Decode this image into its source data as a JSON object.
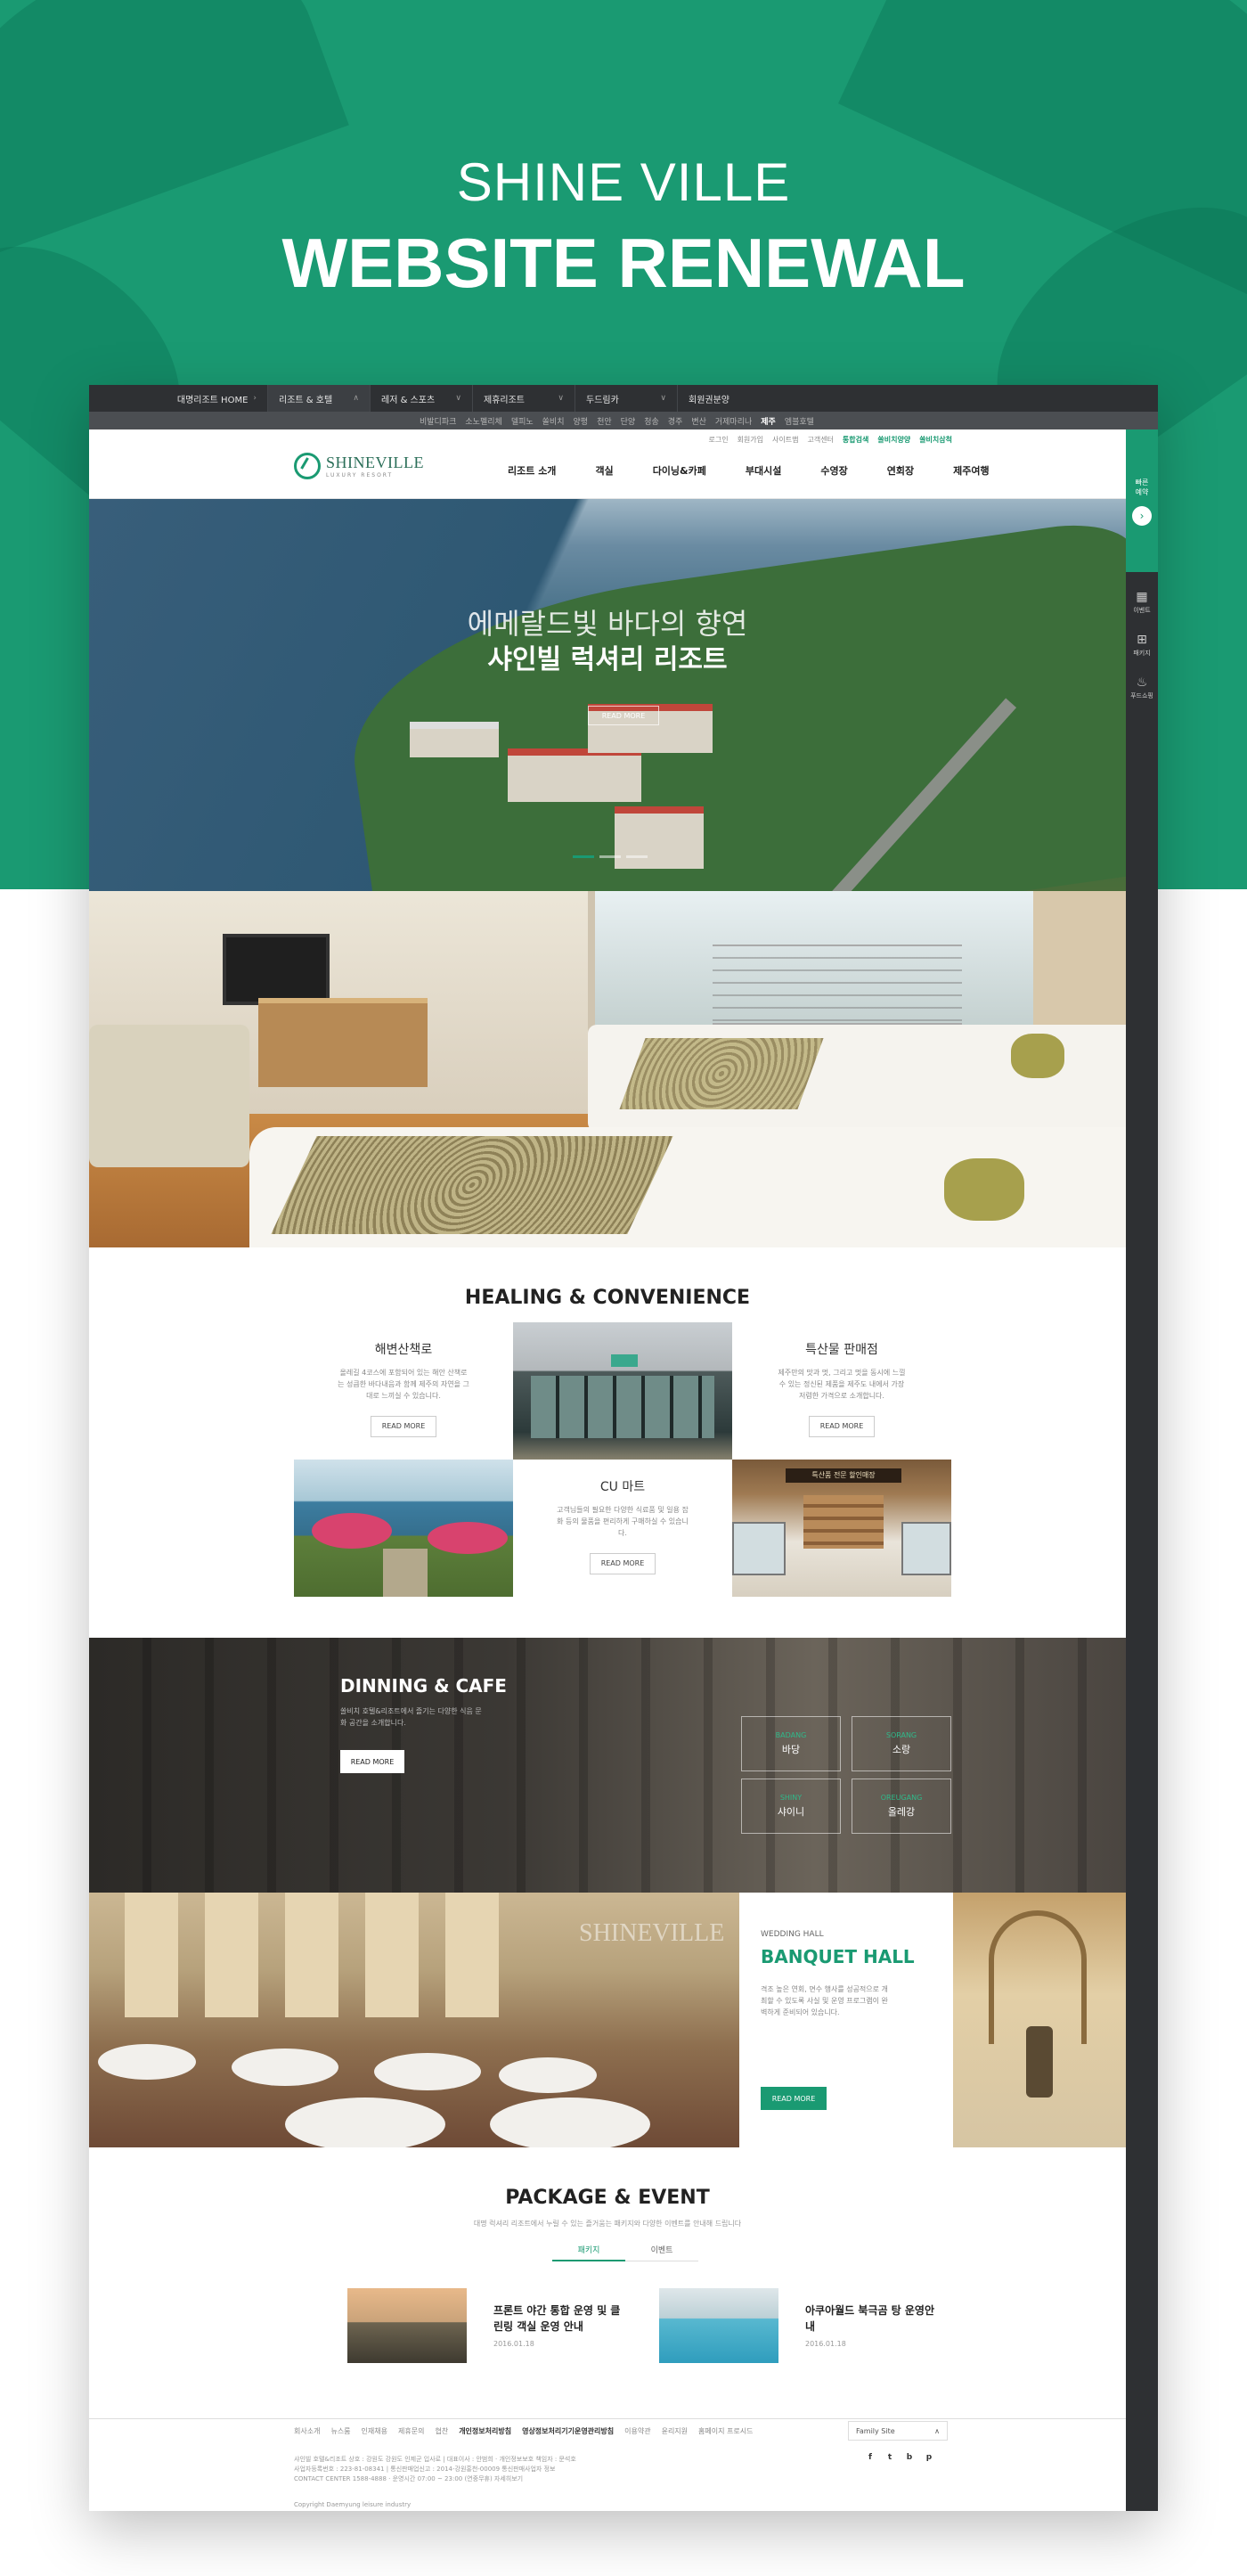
{
  "hero": {
    "line1": "SHINE VILLE",
    "line2": "WEBSITE RENEWAL",
    "bg_color": "#1a9a72"
  },
  "topbar": {
    "home_label": "대명리조트 HOME",
    "menus": [
      {
        "label": "리조트 & 호텔",
        "active": true
      },
      {
        "label": "레저 & 스포츠",
        "active": false
      },
      {
        "label": "제휴리조트",
        "active": false
      },
      {
        "label": "두드림카",
        "active": false
      },
      {
        "label": "회원권분양",
        "active": false
      }
    ]
  },
  "subbar": {
    "items": [
      "비발디파크",
      "소노펠리체",
      "델피노",
      "쏠비치",
      "양평",
      "천안",
      "단양",
      "청송",
      "경주",
      "변산",
      "거제마리나",
      "제주",
      "엠블호텔"
    ],
    "current": "제주"
  },
  "header": {
    "logo_name": "SHINEVILLE",
    "logo_sub": "LUXURY RESORT",
    "util_links": [
      "로그인",
      "회원가입",
      "사이트맵",
      "고객센터"
    ],
    "util_green": [
      "통합검색",
      "쏠비치양양",
      "쏠비치삼척"
    ],
    "gnb": [
      "리조트 소개",
      "객실",
      "다이닝&카페",
      "부대시설",
      "수영장",
      "연회장",
      "제주여행"
    ]
  },
  "quick": {
    "top_label": "빠른 예약",
    "items": [
      {
        "label": "이벤트",
        "icon": "calendar-icon"
      },
      {
        "label": "패키지",
        "icon": "gift-icon"
      },
      {
        "label": "푸드쇼핑",
        "icon": "food-icon"
      }
    ]
  },
  "slide": {
    "caption1": "에메랄드빛 바다의 향연",
    "caption2": "샤인빌 럭셔리 리조트",
    "button": "READ MORE"
  },
  "healing": {
    "title": "HEALING & CONVENIENCE",
    "items": [
      {
        "title": "해변산책로",
        "desc": "올레길 4코스에 포함되어 있는 해안 산책로는 성큼한 바다내음과 함께 제주의 자연을 그대로 느끼실 수 있습니다.",
        "button": "READ MORE"
      },
      {
        "title": "특산물 판매점",
        "desc": "제주만의 맛과 멋, 그리고 멋을 동시에 느낄 수 있는 정신된 제품을 제주도 내에서 가장 저렴한 가격으로 소개합니다.",
        "button": "READ MORE"
      },
      {
        "title": "CU 마트",
        "desc": "고객님들의 필요한 다양한 식료품 및 일용 잡화 등의 물품을 편리하게 구매하실 수 있습니다.",
        "button": "READ MORE"
      }
    ],
    "store_sign": "특산품 전문 할인매장"
  },
  "dining": {
    "title": "DINNING & CAFE",
    "desc": "쏠비치 호텔&리조트에서 즐기는 다양한 식음 문화 공간을 소개합니다.",
    "button": "READ MORE",
    "venues": [
      {
        "en": "BADANG",
        "ko": "바당"
      },
      {
        "en": "SORANG",
        "ko": "소랑"
      },
      {
        "en": "SHINY",
        "ko": "샤이니"
      },
      {
        "en": "OREUGANG",
        "ko": "올레강"
      }
    ]
  },
  "banquet": {
    "kicker": "WEDDING HALL",
    "title": "BANQUET HALL",
    "desc": "격조 높은 연회, 면수 행사를 성공적으로 개최할 수 있도록 사실 및 운영 프로그램이 완벽하게 준비되어 있습니다.",
    "button": "READ MORE",
    "watermark": "SHINEVILLE"
  },
  "package": {
    "title": "PACKAGE & EVENT",
    "desc": "대명 럭셔리 리조트에서 누릴 수 있는 즐거움는 패키지와 다양한 이벤트를 안내해 드립니다",
    "tabs": [
      {
        "label": "패키지",
        "active": true
      },
      {
        "label": "이벤트",
        "active": false
      }
    ],
    "items": [
      {
        "title": "프론트 야간 통합 운영 및 클린링 객실 운영 안내",
        "date": "2016.01.18"
      },
      {
        "title": "아쿠아월드 북극곰 탕 운영안내",
        "date": "2016.01.18"
      }
    ]
  },
  "footer": {
    "links": [
      {
        "label": "회사소개",
        "bold": false
      },
      {
        "label": "뉴스룸",
        "bold": false
      },
      {
        "label": "인재채용",
        "bold": false
      },
      {
        "label": "제휴문의",
        "bold": false
      },
      {
        "label": "협찬",
        "bold": false
      },
      {
        "label": "개인정보처리방침",
        "bold": true
      },
      {
        "label": "영상정보처리기기운영관리방침",
        "bold": true
      },
      {
        "label": "이용약관",
        "bold": false
      },
      {
        "label": "윤리지원",
        "bold": false
      },
      {
        "label": "홈페이지 프로시드",
        "bold": false
      }
    ],
    "family_site": "Family Site",
    "address_lines": [
      "샤인빌 호텔&리조트 상호 : 강원도 강원도 인제군 입사로 | 대표이사 : 안범희 · 개인정보보호 책임자 : 문석호",
      "사업자등록번호 : 223-81-08341 | 통신판매업신고 : 2014-강원홍천-00009  통신판매사업자 정보",
      "CONTACT CENTER 1588-4888 · 운영시간 07:00 ~ 23:00 (연중무휴)  자세히보기"
    ],
    "copyright": "Copyright Daemyung leisure industry",
    "sns": [
      "f",
      "t",
      "b",
      "p"
    ]
  }
}
